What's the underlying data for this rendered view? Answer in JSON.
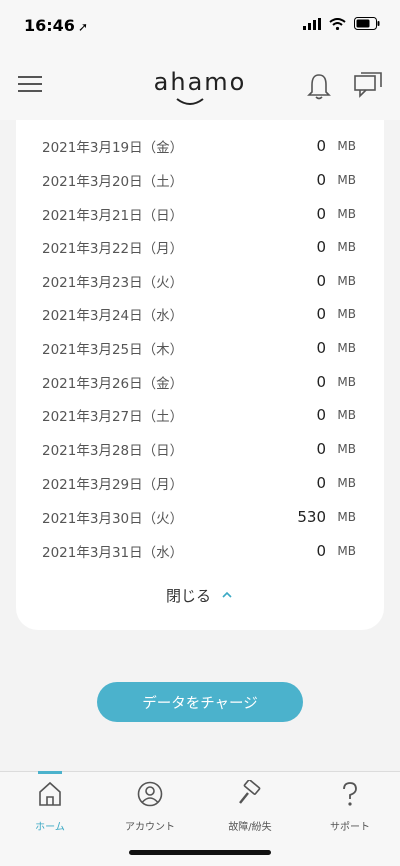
{
  "status_bar": {
    "time": "16:46"
  },
  "header": {
    "logo": "ahamo"
  },
  "usage": {
    "unit": "MB",
    "rows": [
      {
        "date": "2021年3月19日（金）",
        "value": "0"
      },
      {
        "date": "2021年3月20日（土）",
        "value": "0"
      },
      {
        "date": "2021年3月21日（日）",
        "value": "0"
      },
      {
        "date": "2021年3月22日（月）",
        "value": "0"
      },
      {
        "date": "2021年3月23日（火）",
        "value": "0"
      },
      {
        "date": "2021年3月24日（水）",
        "value": "0"
      },
      {
        "date": "2021年3月25日（木）",
        "value": "0"
      },
      {
        "date": "2021年3月26日（金）",
        "value": "0"
      },
      {
        "date": "2021年3月27日（土）",
        "value": "0"
      },
      {
        "date": "2021年3月28日（日）",
        "value": "0"
      },
      {
        "date": "2021年3月29日（月）",
        "value": "0"
      },
      {
        "date": "2021年3月30日（火）",
        "value": "530"
      },
      {
        "date": "2021年3月31日（水）",
        "value": "0"
      }
    ],
    "close_label": "閉じる"
  },
  "charge_button": {
    "label": "データをチャージ"
  },
  "tabs": [
    {
      "label": "ホーム",
      "icon": "home-icon"
    },
    {
      "label": "アカウント",
      "icon": "account-icon"
    },
    {
      "label": "故障/紛失",
      "icon": "hammer-icon"
    },
    {
      "label": "サポート",
      "icon": "help-icon"
    }
  ],
  "colors": {
    "accent": "#4bb2cc",
    "accent_text": "#3ba9c4"
  }
}
